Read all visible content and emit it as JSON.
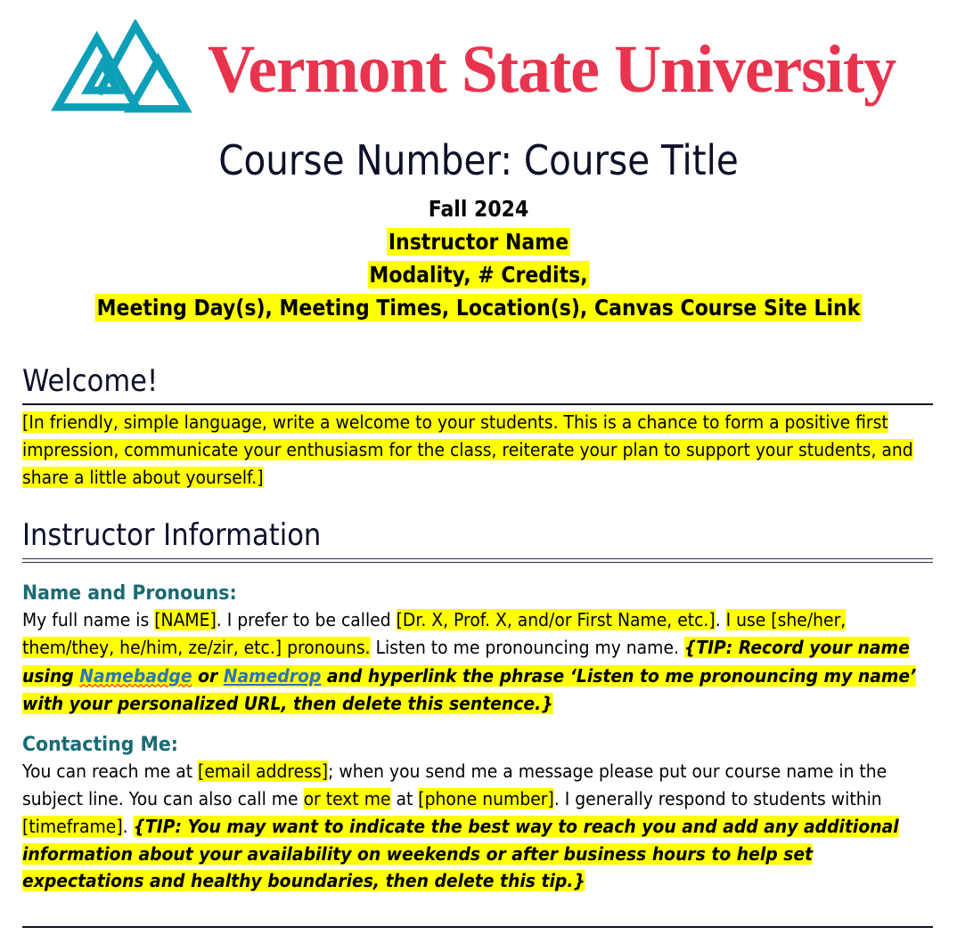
{
  "document": {
    "type": "syllabus-template",
    "page_background": "#ffffff",
    "highlight_color": "#ffff00",
    "brand": {
      "logo_teal": "#00a0b8",
      "wordmark_red": "#e8344e",
      "heading_teal": "#186b73",
      "title_navy": "#0d1028",
      "link_blue": "#2e74b5",
      "spellcheck_red": "#ff0000"
    }
  },
  "masthead": {
    "logo_name": "vermont-state-university-mountains-logo",
    "wordmark": "Vermont State University"
  },
  "title_block": {
    "course_title": "Course Number: Course Title",
    "term": "Fall 2024",
    "instructor_name": "Instructor Name",
    "modality_credits": "Modality, # Credits,",
    "meeting_info": "Meeting Day(s), Meeting Times, Location(s), Canvas Course Site Link"
  },
  "welcome_section": {
    "heading": "Welcome!",
    "body_highlight": "[In friendly, simple language, write a welcome to your students. This is a chance to form a positive first impression, communicate your enthusiasm for the class, reiterate your plan to support your students, and share a little about yourself.]"
  },
  "instructor_information": {
    "heading": "Instructor Information",
    "name_and_pronouns": {
      "subheading": "Name and Pronouns:",
      "t1": "My full name is ",
      "h1": "[NAME]",
      "t2": ". I prefer to be called ",
      "h2": "[Dr. X, Prof. X, and/or First Name, etc.]",
      "t3": ". ",
      "h3": "I use [she/her, them/they, he/him, ze/zir, etc.] pronouns.",
      "t4": " Listen to me pronouncing my name. ",
      "tip_a": "{TIP: Record your name using ",
      "link1": "Namebadge",
      "tip_b": " or ",
      "link2": "Namedrop",
      "tip_c": " and hyperlink the phrase ‘Listen to me pronouncing my name’ with your personalized URL, then delete this sentence.}"
    },
    "contacting_me": {
      "subheading": "Contacting Me:",
      "t1": "You can reach me at ",
      "h1": "[email address]",
      "t2": "; when you send me a message please put our course name in the subject line. You can also call me ",
      "h2": "or text me",
      "t3": " at ",
      "h3": "[phone number]",
      "t4": ". I generally respond to students within ",
      "h4": "[timeframe]",
      "t5": ". ",
      "tip": "{TIP: You may want to indicate the best way to reach you and add any additional information about your availability on weekends or after business hours to help set expectations and healthy boundaries, then delete this tip.}"
    }
  }
}
